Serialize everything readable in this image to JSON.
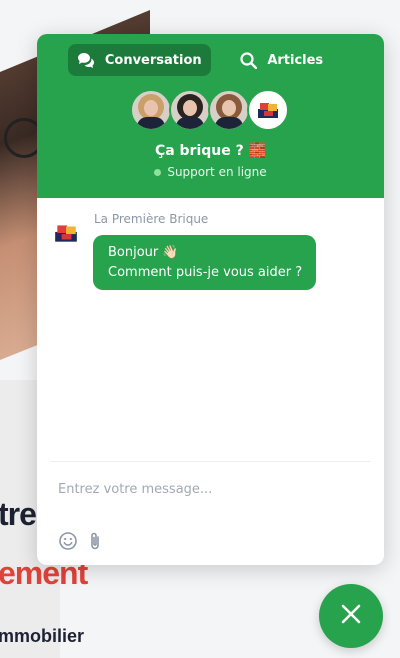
{
  "background": {
    "title_fragment": "tre",
    "subtitle_fragment": "ement",
    "tagline_fragment": "mmobilier"
  },
  "chat": {
    "tabs": [
      {
        "label": "Conversation",
        "icon": "chat-bubbles-icon",
        "active": true
      },
      {
        "label": "Articles",
        "icon": "search-icon",
        "active": false
      }
    ],
    "team_name": "Ça brique ? 🧱",
    "status": "Support en ligne",
    "messages": [
      {
        "sender": "La Première Brique",
        "lines": [
          "Bonjour 👋🏻",
          "Comment puis-je vous aider ?"
        ]
      }
    ],
    "composer": {
      "placeholder": "Entrez votre message...",
      "value": ""
    }
  },
  "colors": {
    "accent": "#27a34d",
    "accent_dark": "#1c7a3a",
    "online": "#8ce29c"
  }
}
